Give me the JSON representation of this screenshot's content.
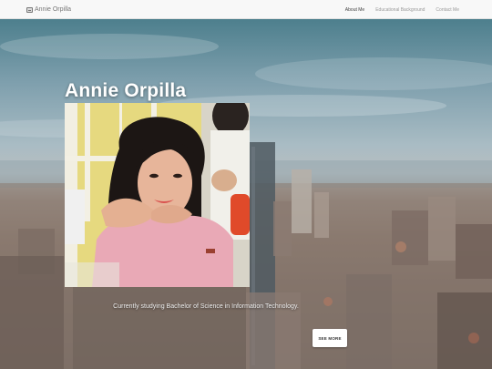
{
  "navbar": {
    "brand_label": "Annie Orpilla",
    "links": [
      {
        "label": "About Me",
        "active": true
      },
      {
        "label": "Educational Background",
        "active": false
      },
      {
        "label": "Contact Me",
        "active": false
      }
    ]
  },
  "hero": {
    "title": "Annie Orpilla",
    "tagline": "Currently studying Bachelor of Science in Information Technology.",
    "button_label": "SEE MORE"
  },
  "icons": {
    "brand": "picture-icon"
  }
}
